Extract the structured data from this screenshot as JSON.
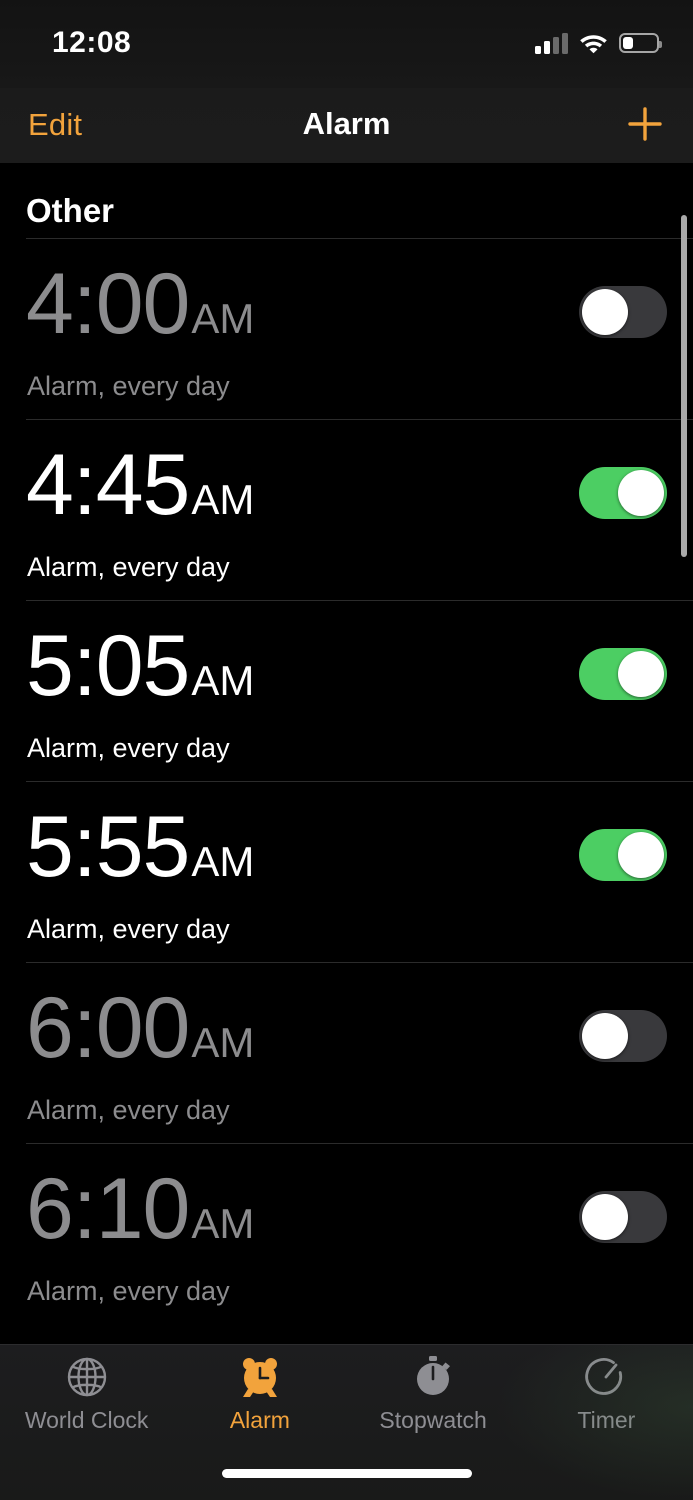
{
  "status_bar": {
    "time": "12:08",
    "cellular_icon": "cellular-signal-icon",
    "cellular_bars_filled": 2,
    "cellular_bars_total": 4,
    "wifi_icon": "wifi-icon",
    "battery_icon": "battery-icon",
    "battery_level_percent": 27
  },
  "nav_bar": {
    "edit_label": "Edit",
    "title": "Alarm",
    "add_icon": "plus-icon",
    "accent_color": "#f2a33c"
  },
  "list": {
    "section_title": "Other",
    "alarms": [
      {
        "time": "4:00",
        "meridiem": "AM",
        "subtitle": "Alarm, every day",
        "enabled": false
      },
      {
        "time": "4:45",
        "meridiem": "AM",
        "subtitle": "Alarm, every day",
        "enabled": true
      },
      {
        "time": "5:05",
        "meridiem": "AM",
        "subtitle": "Alarm, every day",
        "enabled": true
      },
      {
        "time": "5:55",
        "meridiem": "AM",
        "subtitle": "Alarm, every day",
        "enabled": true
      },
      {
        "time": "6:00",
        "meridiem": "AM",
        "subtitle": "Alarm, every day",
        "enabled": false
      },
      {
        "time": "6:10",
        "meridiem": "AM",
        "subtitle": "Alarm, every day",
        "enabled": false
      }
    ],
    "toggle_on_color": "#4cce63",
    "toggle_off_color": "#39393c",
    "disabled_text_color": "#8c8c8e",
    "enabled_text_color": "#ffffff"
  },
  "tab_bar": {
    "active_tab": "Alarm",
    "tabs": [
      {
        "label": "World Clock",
        "icon": "globe-icon",
        "active": false
      },
      {
        "label": "Alarm",
        "icon": "alarm-clock-icon",
        "active": true
      },
      {
        "label": "Stopwatch",
        "icon": "stopwatch-icon",
        "active": false
      },
      {
        "label": "Timer",
        "icon": "timer-icon",
        "active": false
      }
    ]
  }
}
